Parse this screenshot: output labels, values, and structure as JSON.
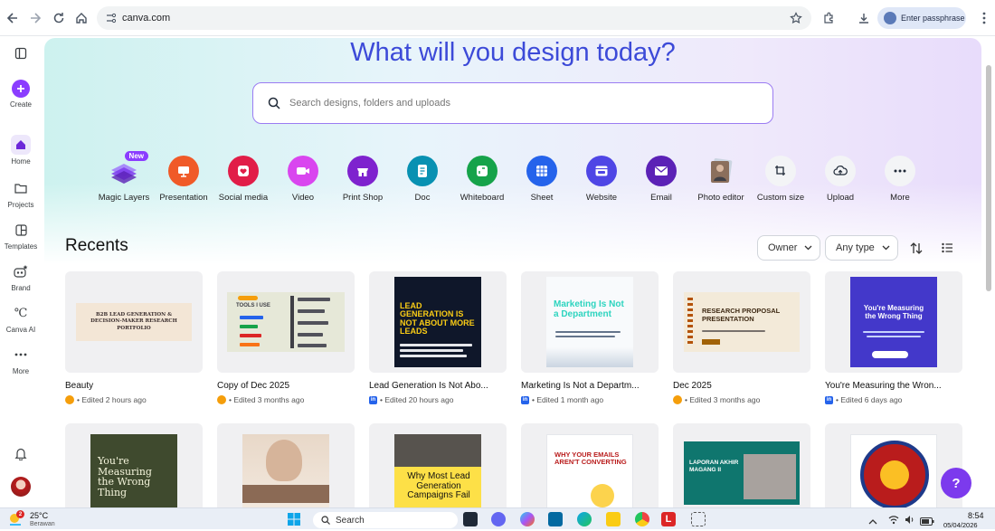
{
  "browser": {
    "url": "canva.com",
    "profile_label": "Enter passphrase"
  },
  "sidebar": {
    "items": [
      {
        "label": "Create",
        "icon": "plus-icon"
      },
      {
        "label": "Home",
        "icon": "home-icon"
      },
      {
        "label": "Projects",
        "icon": "folder-icon"
      },
      {
        "label": "Templates",
        "icon": "templates-icon"
      },
      {
        "label": "Brand",
        "icon": "brand-icon"
      },
      {
        "label": "Canva AI",
        "icon": "canva-ai-icon"
      },
      {
        "label": "More",
        "icon": "more-icon"
      }
    ]
  },
  "hero": {
    "headline": "What will you design today?",
    "search_placeholder": "Search designs, folders and uploads"
  },
  "quick_actions": [
    {
      "label": "Magic Layers",
      "color": "#7c3aed",
      "badge": "New"
    },
    {
      "label": "Presentation",
      "color": "#f05a28"
    },
    {
      "label": "Social media",
      "color": "#e11d48"
    },
    {
      "label": "Video",
      "color": "#d946ef"
    },
    {
      "label": "Print Shop",
      "color": "#7e22ce"
    },
    {
      "label": "Doc",
      "color": "#0891b2"
    },
    {
      "label": "Whiteboard",
      "color": "#16a34a"
    },
    {
      "label": "Sheet",
      "color": "#2563eb"
    },
    {
      "label": "Website",
      "color": "#4f46e5"
    },
    {
      "label": "Email",
      "color": "#5b21b6"
    },
    {
      "label": "Photo editor",
      "color": "#6b7280"
    },
    {
      "label": "Custom size",
      "color": "#f3f4f6"
    },
    {
      "label": "Upload",
      "color": "#f3f4f6"
    },
    {
      "label": "More",
      "color": "#f3f4f6"
    }
  ],
  "recents": {
    "title": "Recents",
    "owner_filter": "Owner",
    "type_filter": "Any type"
  },
  "designs": [
    {
      "title": "Beauty",
      "meta": "Edited 2 hours ago",
      "owner": "own",
      "thumb_text": "B2B LEAD GENERATION & DECISION-MAKER RESEARCH PORTFOLIO"
    },
    {
      "title": "Copy of Dec 2025",
      "meta": "Edited 3 months ago",
      "owner": "own",
      "thumb_text": "TOOLS I USE"
    },
    {
      "title": "Lead Generation Is Not Abo...",
      "meta": "Edited 20 hours ago",
      "owner": "linkedin",
      "thumb_text": "LEAD GENERATION IS NOT ABOUT MORE LEADS"
    },
    {
      "title": "Marketing Is Not a Departm...",
      "meta": "Edited 1 month ago",
      "owner": "linkedin",
      "thumb_text": "Marketing Is Not a Department"
    },
    {
      "title": "Dec 2025",
      "meta": "Edited 3 months ago",
      "owner": "own",
      "thumb_text": "RESEARCH PROPOSAL PRESENTATION"
    },
    {
      "title": "You're Measuring the Wron...",
      "meta": "Edited 6 days ago",
      "owner": "linkedin",
      "thumb_text": "You're Measuring the Wrong Thing"
    }
  ],
  "designs_row2": [
    {
      "thumb_text": "You're Measuring the Wrong Thing"
    },
    {
      "thumb_text": ""
    },
    {
      "thumb_text": "Why Most Lead Generation Campaigns Fail"
    },
    {
      "thumb_text": "WHY YOUR EMAILS AREN'T CONVERTING"
    },
    {
      "thumb_text": "LAPORAN AKHIR MAGANG II"
    },
    {
      "thumb_text": ""
    }
  ],
  "help_label": "?",
  "taskbar": {
    "weather_temp": "25°C",
    "weather_desc": "Berawan",
    "search_label": "Search",
    "time": "8:54",
    "date": "05/04/2026"
  }
}
